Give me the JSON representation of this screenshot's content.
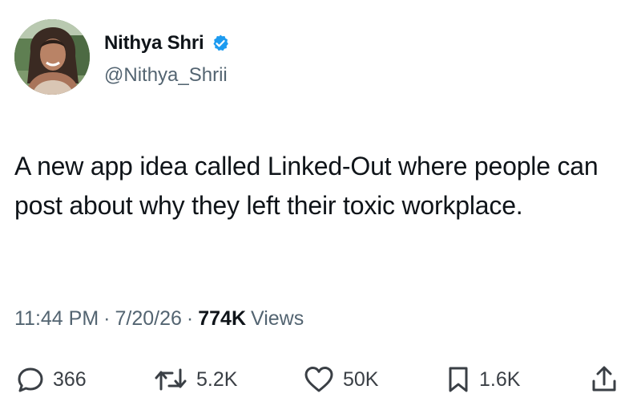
{
  "author": {
    "display_name": "Nithya Shri",
    "handle": "@Nithya_Shrii",
    "verified": true
  },
  "tweet": {
    "text": "A new app idea called Linked-Out where people can post about why they left their toxic workplace.",
    "time": "11:44 PM",
    "date": "7/20/26",
    "separator": "·",
    "views_count": "774K",
    "views_label": "Views"
  },
  "actions": {
    "replies": "366",
    "retweets": "5.2K",
    "likes": "50K",
    "bookmarks": "1.6K"
  },
  "colors": {
    "text": "#0f1419",
    "secondary": "#536471",
    "verified_badge": "#1d9bf0",
    "icons": "#3a3f45"
  },
  "icons": {
    "reply": "reply-icon",
    "retweet": "retweet-icon",
    "like": "heart-icon",
    "bookmark": "bookmark-icon",
    "share": "share-icon",
    "verified": "verified-badge-icon"
  }
}
